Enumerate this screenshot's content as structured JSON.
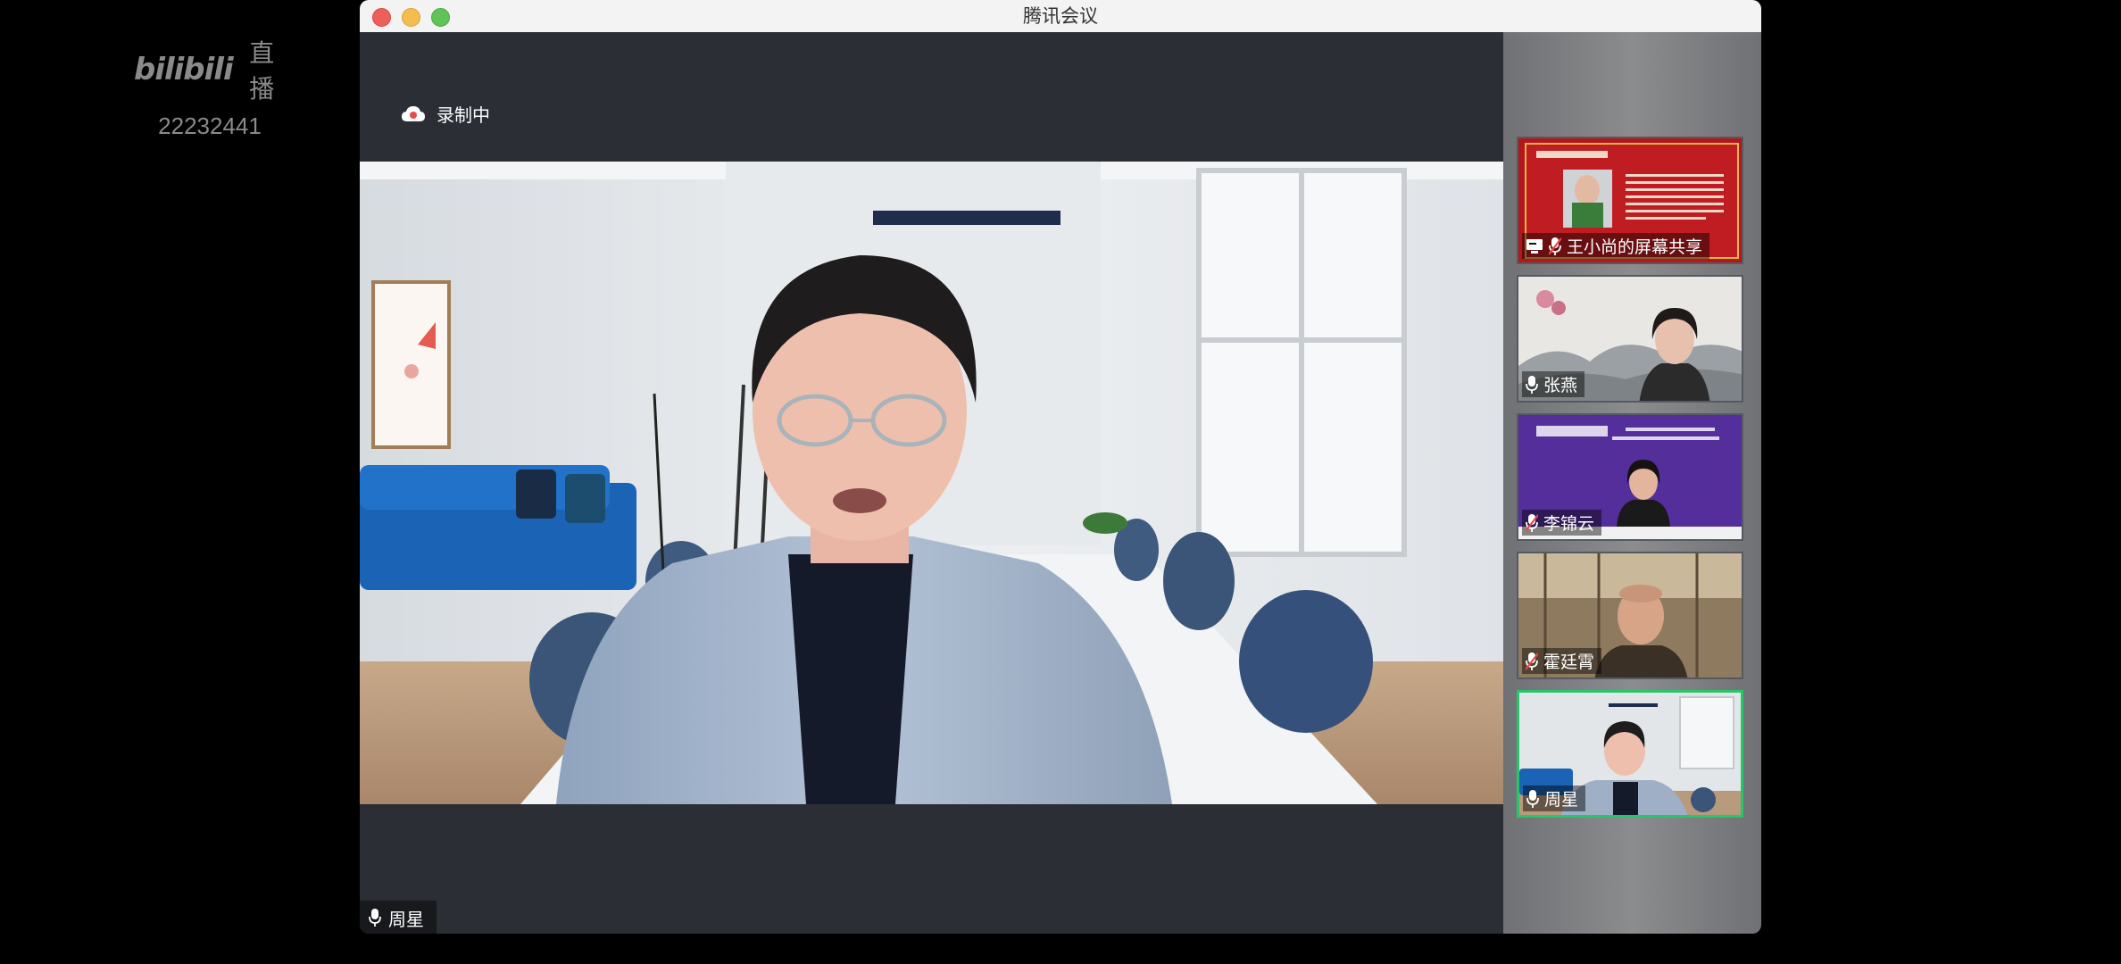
{
  "watermark": {
    "logo": "bilibili",
    "live": "直播",
    "room_id": "22232441"
  },
  "window": {
    "title": "腾讯会议"
  },
  "recording": {
    "label": "录制中"
  },
  "main_speaker": {
    "name": "周星"
  },
  "participants": [
    {
      "name": "王小尚的屏幕共享",
      "screen_share": true,
      "muted": true
    },
    {
      "name": "张燕",
      "muted": false
    },
    {
      "name": "李锦云",
      "muted": true
    },
    {
      "name": "霍廷霄",
      "muted": true
    },
    {
      "name": "周星",
      "muted": false,
      "active": true
    }
  ],
  "colors": {
    "accent_active": "#27c66a",
    "window_bg": "#2b2e35",
    "record_icon": "#e84a4a"
  }
}
